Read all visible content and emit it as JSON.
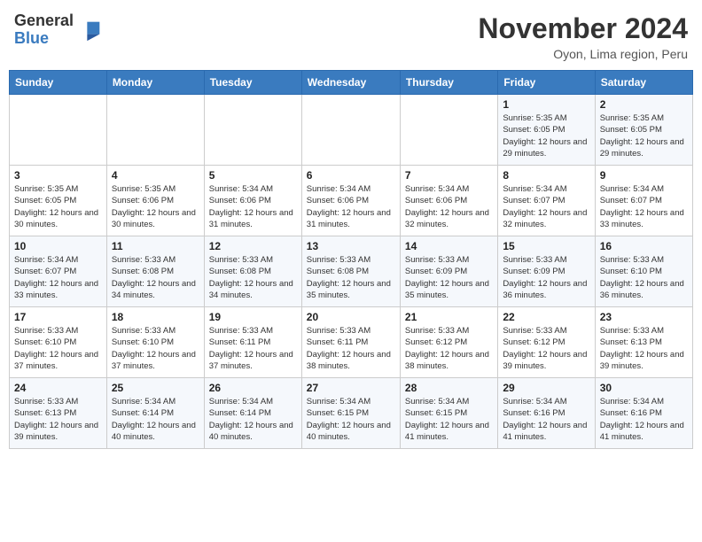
{
  "header": {
    "logo_general": "General",
    "logo_blue": "Blue",
    "month_title": "November 2024",
    "location": "Oyon, Lima region, Peru"
  },
  "weekdays": [
    "Sunday",
    "Monday",
    "Tuesday",
    "Wednesday",
    "Thursday",
    "Friday",
    "Saturday"
  ],
  "weeks": [
    [
      {
        "day": "",
        "detail": ""
      },
      {
        "day": "",
        "detail": ""
      },
      {
        "day": "",
        "detail": ""
      },
      {
        "day": "",
        "detail": ""
      },
      {
        "day": "",
        "detail": ""
      },
      {
        "day": "1",
        "detail": "Sunrise: 5:35 AM\nSunset: 6:05 PM\nDaylight: 12 hours and 29 minutes."
      },
      {
        "day": "2",
        "detail": "Sunrise: 5:35 AM\nSunset: 6:05 PM\nDaylight: 12 hours and 29 minutes."
      }
    ],
    [
      {
        "day": "3",
        "detail": "Sunrise: 5:35 AM\nSunset: 6:05 PM\nDaylight: 12 hours and 30 minutes."
      },
      {
        "day": "4",
        "detail": "Sunrise: 5:35 AM\nSunset: 6:06 PM\nDaylight: 12 hours and 30 minutes."
      },
      {
        "day": "5",
        "detail": "Sunrise: 5:34 AM\nSunset: 6:06 PM\nDaylight: 12 hours and 31 minutes."
      },
      {
        "day": "6",
        "detail": "Sunrise: 5:34 AM\nSunset: 6:06 PM\nDaylight: 12 hours and 31 minutes."
      },
      {
        "day": "7",
        "detail": "Sunrise: 5:34 AM\nSunset: 6:06 PM\nDaylight: 12 hours and 32 minutes."
      },
      {
        "day": "8",
        "detail": "Sunrise: 5:34 AM\nSunset: 6:07 PM\nDaylight: 12 hours and 32 minutes."
      },
      {
        "day": "9",
        "detail": "Sunrise: 5:34 AM\nSunset: 6:07 PM\nDaylight: 12 hours and 33 minutes."
      }
    ],
    [
      {
        "day": "10",
        "detail": "Sunrise: 5:34 AM\nSunset: 6:07 PM\nDaylight: 12 hours and 33 minutes."
      },
      {
        "day": "11",
        "detail": "Sunrise: 5:33 AM\nSunset: 6:08 PM\nDaylight: 12 hours and 34 minutes."
      },
      {
        "day": "12",
        "detail": "Sunrise: 5:33 AM\nSunset: 6:08 PM\nDaylight: 12 hours and 34 minutes."
      },
      {
        "day": "13",
        "detail": "Sunrise: 5:33 AM\nSunset: 6:08 PM\nDaylight: 12 hours and 35 minutes."
      },
      {
        "day": "14",
        "detail": "Sunrise: 5:33 AM\nSunset: 6:09 PM\nDaylight: 12 hours and 35 minutes."
      },
      {
        "day": "15",
        "detail": "Sunrise: 5:33 AM\nSunset: 6:09 PM\nDaylight: 12 hours and 36 minutes."
      },
      {
        "day": "16",
        "detail": "Sunrise: 5:33 AM\nSunset: 6:10 PM\nDaylight: 12 hours and 36 minutes."
      }
    ],
    [
      {
        "day": "17",
        "detail": "Sunrise: 5:33 AM\nSunset: 6:10 PM\nDaylight: 12 hours and 37 minutes."
      },
      {
        "day": "18",
        "detail": "Sunrise: 5:33 AM\nSunset: 6:10 PM\nDaylight: 12 hours and 37 minutes."
      },
      {
        "day": "19",
        "detail": "Sunrise: 5:33 AM\nSunset: 6:11 PM\nDaylight: 12 hours and 37 minutes."
      },
      {
        "day": "20",
        "detail": "Sunrise: 5:33 AM\nSunset: 6:11 PM\nDaylight: 12 hours and 38 minutes."
      },
      {
        "day": "21",
        "detail": "Sunrise: 5:33 AM\nSunset: 6:12 PM\nDaylight: 12 hours and 38 minutes."
      },
      {
        "day": "22",
        "detail": "Sunrise: 5:33 AM\nSunset: 6:12 PM\nDaylight: 12 hours and 39 minutes."
      },
      {
        "day": "23",
        "detail": "Sunrise: 5:33 AM\nSunset: 6:13 PM\nDaylight: 12 hours and 39 minutes."
      }
    ],
    [
      {
        "day": "24",
        "detail": "Sunrise: 5:33 AM\nSunset: 6:13 PM\nDaylight: 12 hours and 39 minutes."
      },
      {
        "day": "25",
        "detail": "Sunrise: 5:34 AM\nSunset: 6:14 PM\nDaylight: 12 hours and 40 minutes."
      },
      {
        "day": "26",
        "detail": "Sunrise: 5:34 AM\nSunset: 6:14 PM\nDaylight: 12 hours and 40 minutes."
      },
      {
        "day": "27",
        "detail": "Sunrise: 5:34 AM\nSunset: 6:15 PM\nDaylight: 12 hours and 40 minutes."
      },
      {
        "day": "28",
        "detail": "Sunrise: 5:34 AM\nSunset: 6:15 PM\nDaylight: 12 hours and 41 minutes."
      },
      {
        "day": "29",
        "detail": "Sunrise: 5:34 AM\nSunset: 6:16 PM\nDaylight: 12 hours and 41 minutes."
      },
      {
        "day": "30",
        "detail": "Sunrise: 5:34 AM\nSunset: 6:16 PM\nDaylight: 12 hours and 41 minutes."
      }
    ]
  ]
}
